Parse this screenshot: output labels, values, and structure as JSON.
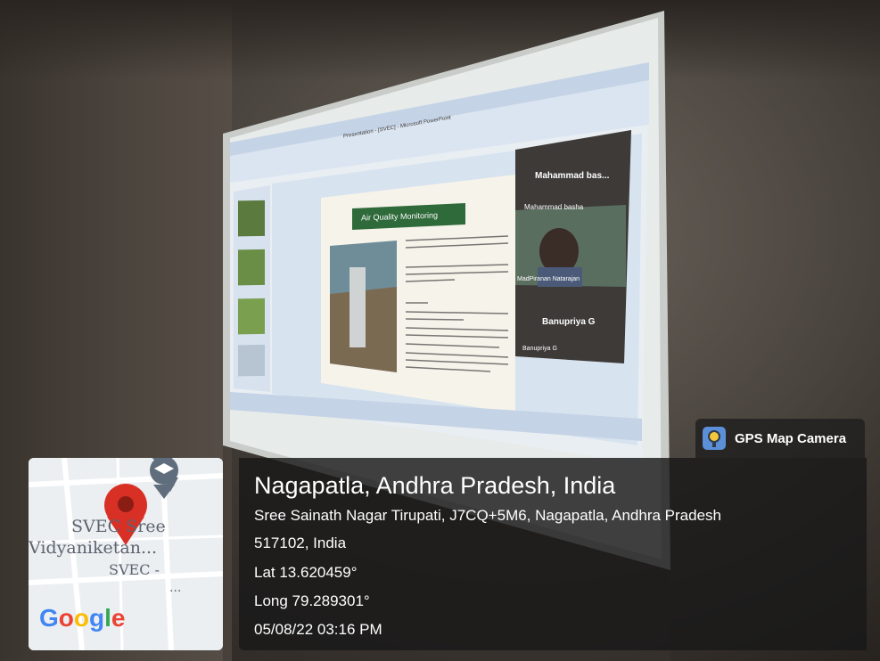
{
  "gps_badge": {
    "app_name": "GPS Map Camera",
    "icon": "gps-map-camera-icon"
  },
  "location": {
    "title": "Nagapatla, Andhra Pradesh, India",
    "address_line1": "Sree Sainath Nagar Tirupati, J7CQ+5M6, Nagapatla, Andhra Pradesh",
    "address_line2": "517102, India",
    "lat": "Lat 13.620459°",
    "long": "Long 79.289301°",
    "datetime": "05/08/22 03:16 PM"
  },
  "map": {
    "label_line1": "SVEC Sree",
    "label_line2": "Vidyaniketan...",
    "label_line3": "SVEC -",
    "ellipsis": "...",
    "provider_logo": "Google",
    "pin_icon": "location-pin-icon",
    "poi_icon": "graduation-cap-icon",
    "colors": {
      "pin": "#d93025",
      "poi": "#5f6d7d"
    }
  },
  "slide": {
    "title": "Air Quality Monitoring",
    "bullets": [
      "National Air Quality Monitoring programme started by CPCB in 1990",
      "In this programme, 342 stations monitors 127 cities/towns in 26 states & 4 union territory",
      "Objective:",
      "To determine status & trends of Ambient Air Quality",
      "To ascertain whether the prescribed Ambient Air quality standards are violated",
      "To identify Non - attainment cities",
      "To obtain the knowledge and understanding for developing preventive and corrective measures"
    ]
  },
  "video_tiles": [
    {
      "name": "Mahammad bas...",
      "caption": "Mahammad basha"
    },
    {
      "name": "",
      "caption": "MadPiranan Natarajan"
    },
    {
      "name": "Banupriya G",
      "caption": "Banupriya G"
    }
  ],
  "window": {
    "title": "Presentation - [SVEC] - Microsoft PowerPoint"
  }
}
